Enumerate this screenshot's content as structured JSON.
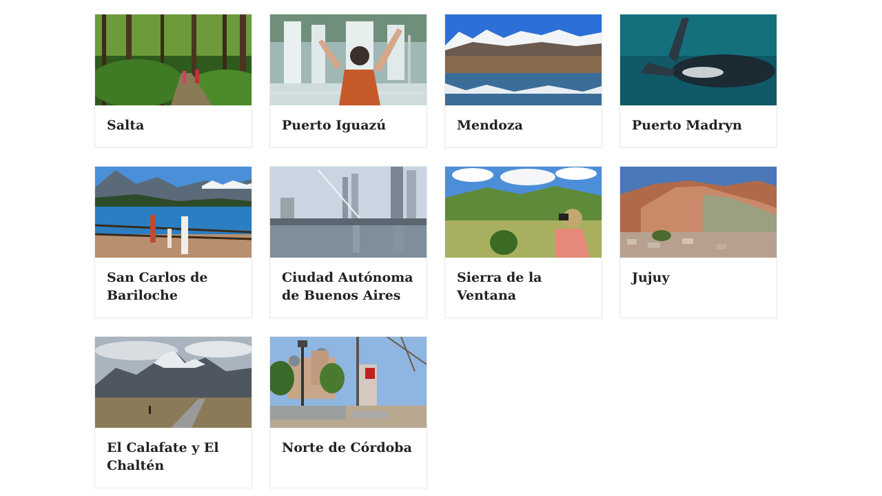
{
  "destinations": [
    {
      "name": "Salta",
      "image": "forest-hikers-photo"
    },
    {
      "name": "Puerto Iguazú",
      "image": "waterfall-boat-photo"
    },
    {
      "name": "Mendoza",
      "image": "snowy-mountains-lake-photo"
    },
    {
      "name": "Puerto Madryn",
      "image": "whale-ocean-photo"
    },
    {
      "name": "San Carlos de Bariloche",
      "image": "lake-viewpoint-photo"
    },
    {
      "name": "Ciudad Autónoma de Buenos Aires",
      "image": "city-bridge-photo"
    },
    {
      "name": "Sierra de la Ventana",
      "image": "green-hills-binoculars-photo"
    },
    {
      "name": "Jujuy",
      "image": "colored-hill-village-photo"
    },
    {
      "name": "El Calafate y El Chaltén",
      "image": "fitz-roy-road-photo"
    },
    {
      "name": "Norte de Córdoba",
      "image": "town-plaza-church-photo"
    }
  ]
}
